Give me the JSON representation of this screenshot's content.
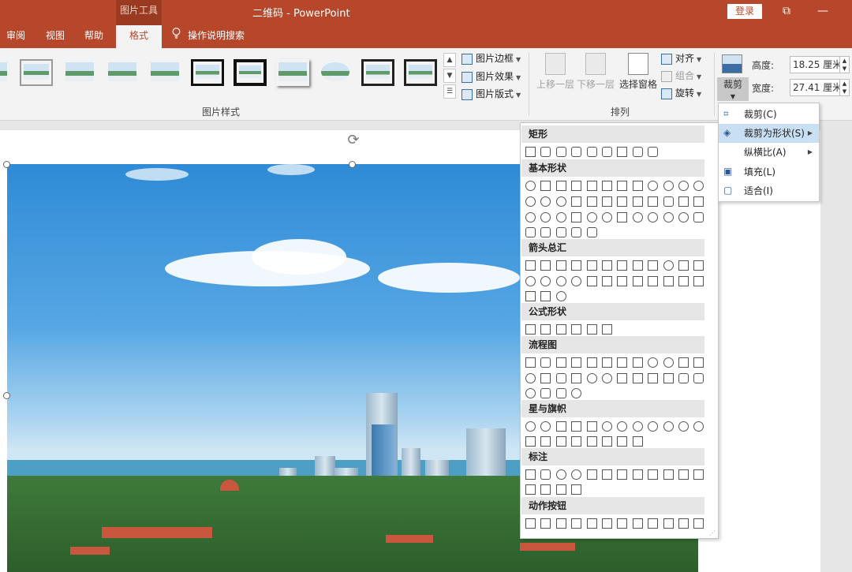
{
  "titlebar": {
    "context_label": "图片工具",
    "doc_title": "二维码  -  PowerPoint",
    "login": "登录",
    "restore_glyph": "⧉",
    "minimize_glyph": "—"
  },
  "tabs": [
    {
      "label": "审阅"
    },
    {
      "label": "视图"
    },
    {
      "label": "帮助"
    },
    {
      "label": "格式"
    }
  ],
  "tell_me": "操作说明搜索",
  "ribbon": {
    "picture_styles_group": "图片样式",
    "arrange_group": "排列",
    "picture_border": "图片边框",
    "picture_effects": "图片效果",
    "picture_layout": "图片版式",
    "bring_forward": "上移一层",
    "send_backward": "下移一层",
    "selection_pane": "选择窗格",
    "align": "对齐",
    "group": "组合",
    "rotate": "旋转",
    "crop": "裁剪",
    "height_label": "高度:",
    "height_value": "18.25 厘米",
    "width_label": "宽度:",
    "width_value": "27.41 厘米"
  },
  "shape_menu": {
    "categories": [
      "矩形",
      "基本形状",
      "箭头总汇",
      "公式形状",
      "流程图",
      "星与旗帜",
      "标注",
      "动作按钮"
    ]
  },
  "crop_menu": {
    "items": [
      {
        "label": "裁剪(C)",
        "icon": "crop-icon"
      },
      {
        "label": "裁剪为形状(S)",
        "icon": "crop-to-shape-icon",
        "submenu": true,
        "highlighted": true
      },
      {
        "label": "纵横比(A)",
        "icon": "",
        "submenu": true
      },
      {
        "label": "填充(L)",
        "icon": "fill-icon"
      },
      {
        "label": "适合(I)",
        "icon": "fit-icon"
      }
    ]
  },
  "colors": {
    "accent": "#b7472a",
    "highlight": "#c9dff4"
  }
}
